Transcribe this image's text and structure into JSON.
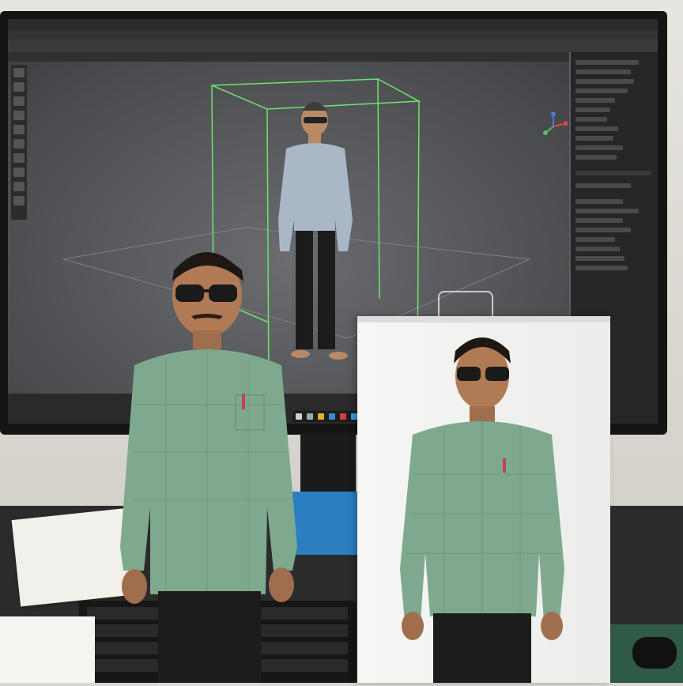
{
  "scene": {
    "description_items": [],
    "colors": {
      "shirt_green": "#7fa98e",
      "shirt_blue_grey": "#a9b7c6",
      "trousers": "#1c1c1c",
      "bbox_green": "#6ee36e",
      "skin": "#b07a55",
      "hair": "#1f1712"
    },
    "icons": {
      "axis_gizmo": "axis-gizmo-icon",
      "move_tool": "move-tool-icon",
      "windows_start": "windows-icon"
    }
  }
}
